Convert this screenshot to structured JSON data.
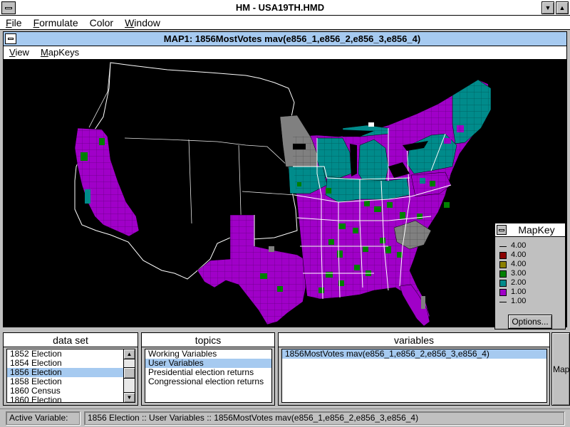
{
  "app": {
    "title": "HM - USA19TH.HMD",
    "menu": [
      {
        "label": "File",
        "accel": "F",
        "rest": "ile"
      },
      {
        "label": "Formulate",
        "accel": "F",
        "rest": "ormulate"
      },
      {
        "label": "Color",
        "accel": "",
        "rest": "Color"
      },
      {
        "label": "Window",
        "accel": "W",
        "rest": "indow"
      }
    ],
    "minimize_icon": "triangle-down",
    "maximize_icon": "triangle-up"
  },
  "map_window": {
    "title": "MAP1: 1856MostVotes mav(e856_1,e856_2,e856_3,e856_4)",
    "menu": [
      {
        "label": "View",
        "accel": "V",
        "rest": "iew"
      },
      {
        "label": "MapKeys",
        "accel": "M",
        "rest": "apKeys"
      }
    ]
  },
  "mapkey": {
    "title": "MapKey",
    "entries": [
      {
        "label": "4.00",
        "color": null
      },
      {
        "label": "4.00",
        "color": "#8b0000"
      },
      {
        "label": "4.00",
        "color": "#8b8000"
      },
      {
        "label": "3.00",
        "color": "#008000"
      },
      {
        "label": "2.00",
        "color": "#008b8b"
      },
      {
        "label": "1.00",
        "color": "#a000c8"
      },
      {
        "label": "1.00",
        "color": null
      }
    ],
    "options_label": "Options..."
  },
  "colors": {
    "republican": "#008b8b",
    "democrat": "#a000c8",
    "american": "#008000",
    "no_data": "#808080",
    "state_line": "#ffffff",
    "selection": "#a6caf0"
  },
  "panels": {
    "data_set": {
      "header": "data set",
      "items": [
        "1852 Election",
        "1854 Election",
        "1856 Election",
        "1858 Election",
        "1860 Census",
        "1860 Election"
      ],
      "selected_index": 2
    },
    "topics": {
      "header": "topics",
      "items": [
        "Working Variables",
        "User Variables",
        "Presidential election returns",
        "Congressional election returns"
      ],
      "selected_index": 1
    },
    "variables": {
      "header": "variables",
      "items": [
        "1856MostVotes mav(e856_1,e856_2,e856_3,e856_4)"
      ],
      "selected_index": 0
    }
  },
  "map_button_label": "Map",
  "status": {
    "label": "Active Variable:",
    "value": "1856 Election :: User Variables :: 1856MostVotes mav(e856_1,e856_2,e856_3,e856_4)"
  }
}
